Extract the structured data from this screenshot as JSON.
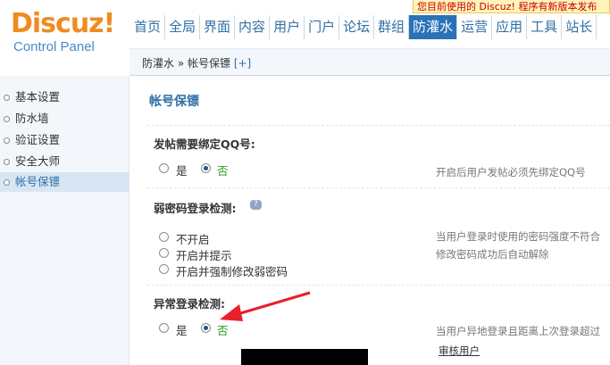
{
  "logo": {
    "brand": "Discuz!",
    "subtitle": "Control Panel"
  },
  "notice": "您目前使用的 Discuz! 程序有新版本发布",
  "nav": [
    "首页",
    "全局",
    "界面",
    "内容",
    "用户",
    "门户",
    "论坛",
    "群组",
    "防灌水",
    "运营",
    "应用",
    "工具",
    "站长"
  ],
  "nav_active": "防灌水",
  "breadcrumb": {
    "text": "防灌水 » 帐号保镖",
    "plus": "[+]"
  },
  "sidebar": [
    "基本设置",
    "防水墙",
    "验证设置",
    "安全大师",
    "帐号保镖"
  ],
  "sidebar_active": "帐号保镖",
  "panel": {
    "title": "帐号保镖",
    "sections": [
      {
        "label": "发帖需要绑定QQ号:",
        "options": [
          "是",
          "否"
        ],
        "selected": "否",
        "desc": "开启后用户发帖必须先绑定QQ号"
      },
      {
        "label": "弱密码登录检测:",
        "options": [
          "不开启",
          "开启并提示",
          "开启并强制修改弱密码"
        ],
        "selected": "",
        "desc1": "当用户登录时使用的密码强度不符合",
        "desc2": "修改密码成功后自动解除"
      },
      {
        "label": "异常登录检测:",
        "options": [
          "是",
          "否"
        ],
        "selected": "否",
        "desc": "当用户异地登录且距离上次登录超过",
        "link": "审核用户"
      }
    ]
  },
  "colors": {
    "brand_orange": "#f08b1e",
    "nav_blue": "#2f6fa6",
    "active_bg": "#2a72b7",
    "arrow_red": "#e8202a"
  }
}
